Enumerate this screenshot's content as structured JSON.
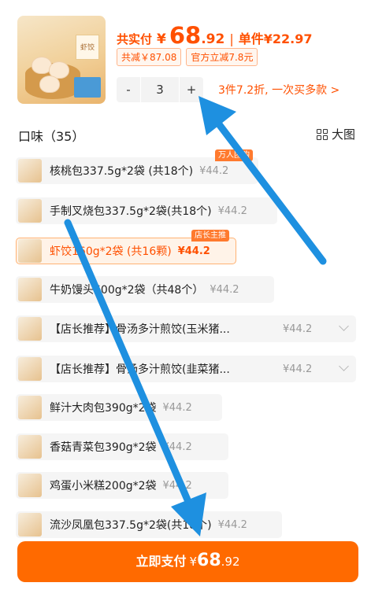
{
  "product": {
    "total_label": "共实付",
    "currency": "¥",
    "total_int": "68",
    "total_dec": ".92",
    "separator": "|",
    "unit_price": "单件¥22.97",
    "discount_total": "共减￥87.08",
    "discount_official": "官方立减7.8元",
    "thumb_badge": "虾饺"
  },
  "quantity": {
    "minus": "-",
    "value": "3",
    "plus": "+",
    "hint": "3件7.2折, 一次买多款 >"
  },
  "flavor": {
    "title": "口味（35）",
    "big_view": "大图"
  },
  "options": [
    {
      "name": "核桃包337.5g*2袋 (共18个)",
      "price": "¥44.2",
      "tag": "万人团购"
    },
    {
      "name": "手制叉烧包337.5g*2袋(共18个)",
      "price": "¥44.2",
      "tag": ""
    },
    {
      "name": "虾饺160g*2袋 (共16颗)",
      "price": "¥44.2",
      "tag": "店长主推"
    },
    {
      "name": "牛奶馒头600g*2袋（共48个）",
      "price": "¥44.2",
      "tag": ""
    },
    {
      "name": "【店长推荐】骨汤多汁煎饺(玉米猪...",
      "price": "¥44.2",
      "tag": ""
    },
    {
      "name": "【店长推荐】骨汤多汁煎饺(韭菜猪...",
      "price": "¥44.2",
      "tag": ""
    },
    {
      "name": "鲜汁大肉包390g*2袋",
      "price": "¥44.2",
      "tag": ""
    },
    {
      "name": "香菇青菜包390g*2袋",
      "price": "¥44.2",
      "tag": ""
    },
    {
      "name": "鸡蛋小米糕200g*2袋",
      "price": "¥44.2",
      "tag": ""
    },
    {
      "name": "流沙凤凰包337.5g*2袋(共18个)",
      "price": "¥44.2",
      "tag": ""
    }
  ],
  "pay": {
    "label": "立即支付",
    "currency": "¥",
    "amount_int": "68",
    "amount_dec": ".92"
  },
  "colors": {
    "accent": "#ff5000",
    "button": "#ff6a00",
    "arrow": "#1e90e0"
  }
}
